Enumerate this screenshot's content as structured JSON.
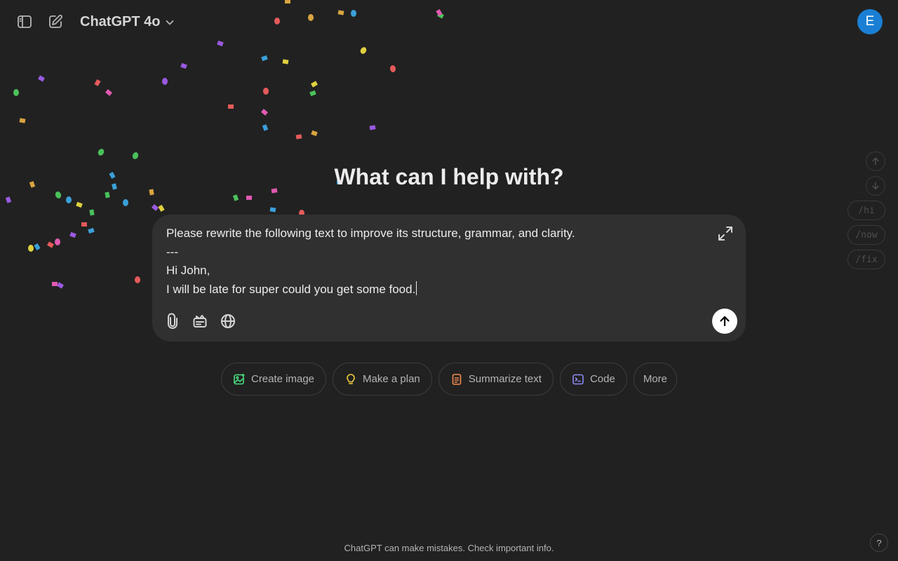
{
  "header": {
    "model_label": "ChatGPT 4o",
    "avatar_initial": "E"
  },
  "main": {
    "heading": "What can I help with?"
  },
  "composer": {
    "lines": [
      "Please rewrite the following text to improve its structure, grammar, and clarity.",
      "---",
      "Hi John,",
      "I will be late for super could you get some food."
    ]
  },
  "chips": [
    {
      "label": "Create image",
      "icon": "image-icon",
      "color": "#4ade80"
    },
    {
      "label": "Make a plan",
      "icon": "lightbulb-icon",
      "color": "#f4d03f"
    },
    {
      "label": "Summarize text",
      "icon": "document-icon",
      "color": "#f28b50"
    },
    {
      "label": "Code",
      "icon": "terminal-icon",
      "color": "#8b8bf5"
    },
    {
      "label": "More",
      "icon": "",
      "color": ""
    }
  ],
  "rail": {
    "commands": [
      "/hi",
      "/now",
      "/fix"
    ]
  },
  "footer": {
    "disclaimer": "ChatGPT can make mistakes. Check important info.",
    "help_label": "?"
  },
  "colors": {
    "background": "#212121",
    "composer": "#303030",
    "avatar": "#1a7fd4",
    "send_button": "#ffffff"
  }
}
